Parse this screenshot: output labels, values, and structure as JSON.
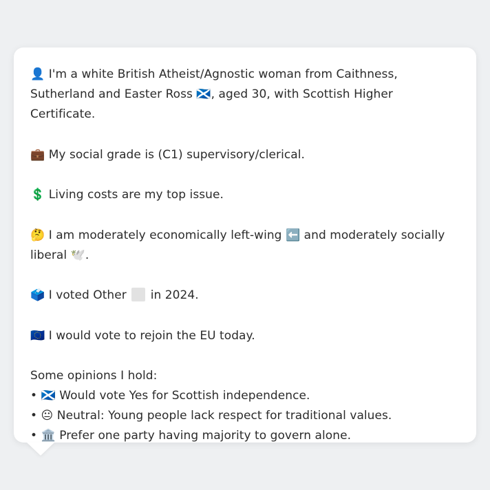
{
  "card": {
    "identity": {
      "icon": "👤",
      "text_a": "I'm a white British Atheist/Agnostic woman from Caithness, Sutherland and Easter Ross ",
      "flag": "🏴󠁧󠁢󠁳󠁣󠁴󠁿",
      "text_b": ", aged 30, with Scottish Higher Certificate."
    },
    "social": {
      "icon": "💼",
      "text": "My social grade is (C1) supervisory/clerical."
    },
    "issue": {
      "icon": "💲",
      "text": "Living costs are my top issue."
    },
    "ideology": {
      "icon": "🤔",
      "text_a": "I am moderately economically left-wing ",
      "left_icon": "⬅️",
      "text_b": " and moderately socially liberal ",
      "dove_icon": "🕊️",
      "text_c": "."
    },
    "vote2024": {
      "icon": "🗳️",
      "text_a": "I voted Other ",
      "text_b": " in 2024."
    },
    "eu": {
      "icon": "🇪🇺",
      "text": "I would vote to rejoin the EU today."
    },
    "opinions": {
      "heading": "Some opinions I hold:",
      "bullet": "•",
      "items": [
        {
          "icon": "🏴󠁧󠁢󠁳󠁣󠁴󠁿",
          "text": "Would vote Yes for Scottish independence."
        },
        {
          "icon": "😐",
          "text": "Neutral: Young people lack respect for traditional values."
        },
        {
          "icon": "🏛️",
          "text": "Prefer one party having majority to govern alone."
        }
      ]
    }
  },
  "colors": {
    "page_bg": "#eef0f2",
    "card_bg": "#ffffff",
    "text": "#2b2b2b",
    "other_party_swatch": "#e2e2e2"
  }
}
